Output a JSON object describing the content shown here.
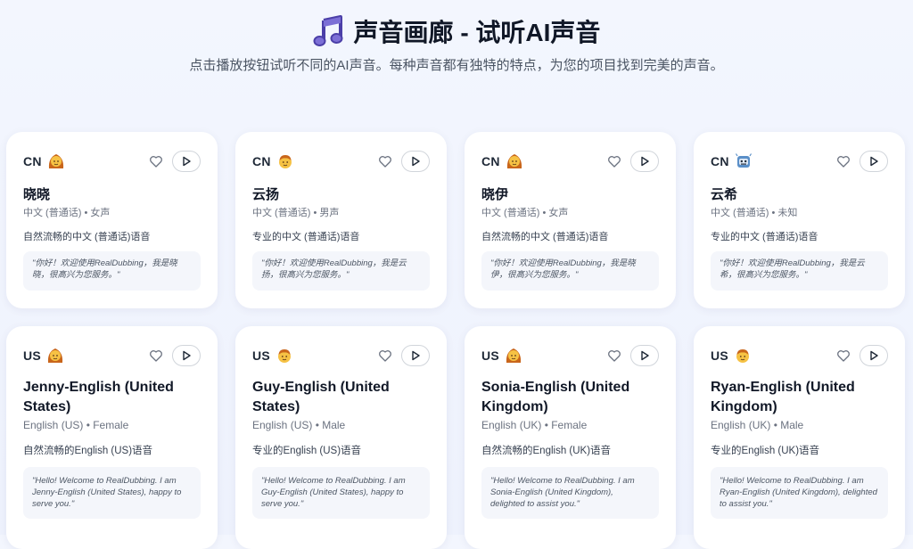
{
  "page": {
    "title": "声音画廊 - 试听AI声音",
    "title_icon": "music-note-icon",
    "subtitle": "点击播放按钮试听不同的AI声音。每种声音都有独特的特点，为您的项目找到完美的声音。"
  },
  "voices": [
    {
      "region": "CN",
      "avatar": "woman-emoji-icon",
      "name": "晓晓",
      "meta": "中文 (普通话) • 女声",
      "desc": "自然流畅的中文 (普通话)语音",
      "sample": "\"你好！欢迎使用RealDubbing，我是晓晓，很高兴为您服务。\""
    },
    {
      "region": "CN",
      "avatar": "man-emoji-icon",
      "name": "云扬",
      "meta": "中文 (普通话) • 男声",
      "desc": "专业的中文 (普通话)语音",
      "sample": "\"你好！欢迎使用RealDubbing，我是云扬，很高兴为您服务。\""
    },
    {
      "region": "CN",
      "avatar": "woman-emoji-icon",
      "name": "晓伊",
      "meta": "中文 (普通话) • 女声",
      "desc": "自然流畅的中文 (普通话)语音",
      "sample": "\"你好！欢迎使用RealDubbing，我是晓伊，很高兴为您服务。\""
    },
    {
      "region": "CN",
      "avatar": "robot-emoji-icon",
      "name": "云希",
      "meta": "中文 (普通话) • 未知",
      "desc": "专业的中文 (普通话)语音",
      "sample": "\"你好！欢迎使用RealDubbing，我是云希，很高兴为您服务。\""
    },
    {
      "region": "US",
      "avatar": "woman-emoji-icon",
      "name": "Jenny-English (United States)",
      "meta": "English (US) • Female",
      "desc": "自然流畅的English (US)语音",
      "sample": "\"Hello! Welcome to RealDubbing. I am Jenny-English (United States), happy to serve you.\""
    },
    {
      "region": "US",
      "avatar": "man-emoji-icon",
      "name": "Guy-English (United States)",
      "meta": "English (US) • Male",
      "desc": "专业的English (US)语音",
      "sample": "\"Hello! Welcome to RealDubbing. I am Guy-English (United States), happy to serve you.\""
    },
    {
      "region": "US",
      "avatar": "woman-emoji-icon",
      "name": "Sonia-English (United Kingdom)",
      "meta": "English (UK) • Female",
      "desc": "自然流畅的English (UK)语音",
      "sample": "\"Hello! Welcome to RealDubbing. I am Sonia-English (United Kingdom), delighted to assist you.\""
    },
    {
      "region": "US",
      "avatar": "man-emoji-icon",
      "name": "Ryan-English (United Kingdom)",
      "meta": "English (UK) • Male",
      "desc": "专业的English (UK)语音",
      "sample": "\"Hello! Welcome to RealDubbing. I am Ryan-English (United Kingdom), delighted to assist you.\""
    }
  ],
  "colors": {
    "accent": "#4b3fa8",
    "woman_hair": "#c9661b",
    "skin": "#f6c244",
    "robot": "#5a8fc8"
  }
}
